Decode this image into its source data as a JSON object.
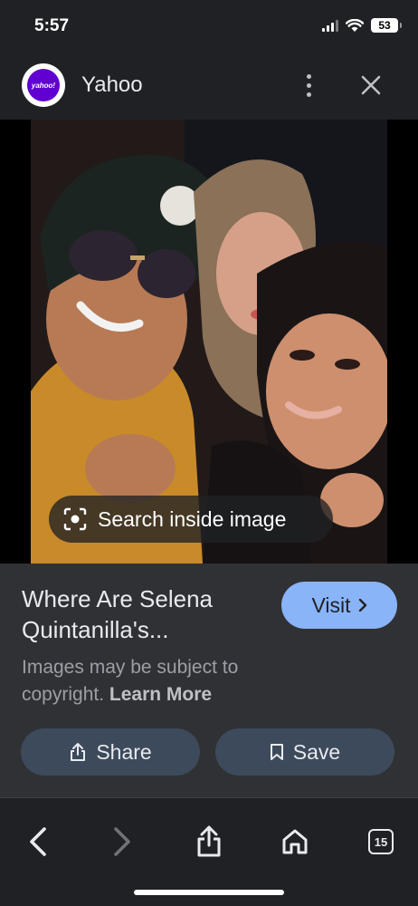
{
  "status_bar": {
    "time": "5:57",
    "battery": "53"
  },
  "header": {
    "site_name": "Yahoo",
    "logo_text": "yahoo!"
  },
  "image": {
    "search_inside_label": "Search inside image"
  },
  "info": {
    "title": "Where Are Selena Quintanilla's...",
    "visit_label": "Visit",
    "copyright_text": "Images may be subject to copyright.",
    "learn_more_label": "Learn More",
    "share_label": "Share",
    "save_label": "Save"
  },
  "toolbar": {
    "tab_count": "15"
  },
  "colors": {
    "accent": "#8ab4f8",
    "background": "#202124",
    "panel": "#303134",
    "button": "#3c4a5c",
    "brand": "#6001d2"
  }
}
